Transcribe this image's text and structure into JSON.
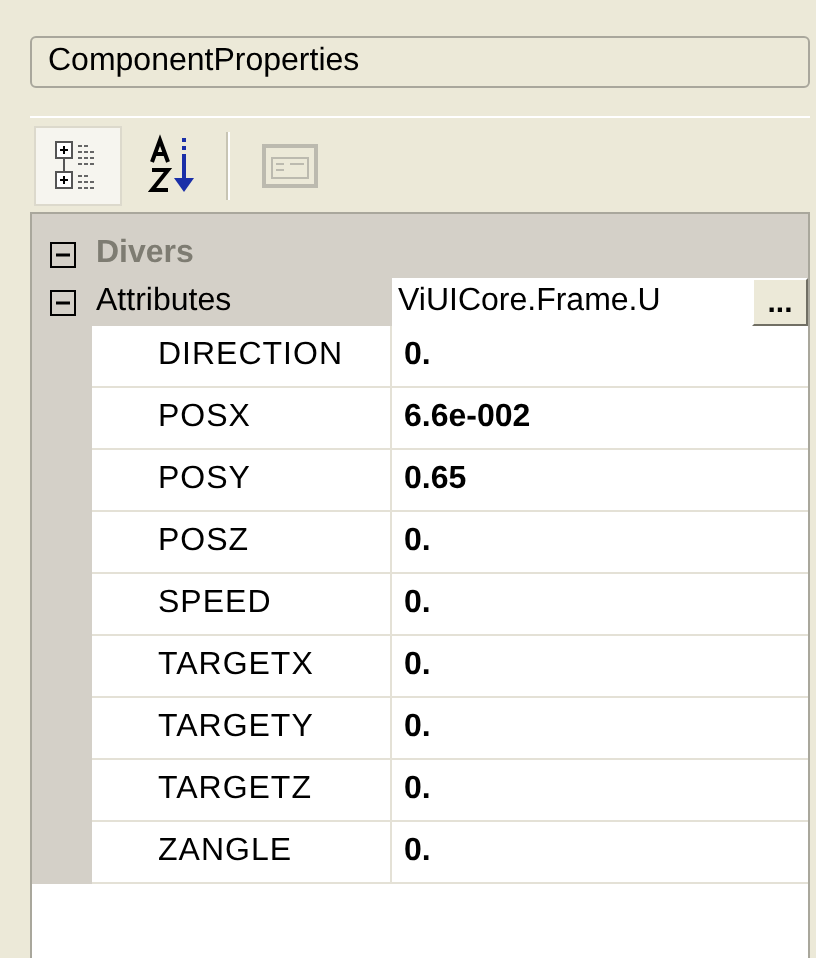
{
  "object_selector": {
    "value": "ComponentProperties"
  },
  "toolbar": [
    {
      "kind": "categorized",
      "selected": true,
      "disabled": false
    },
    {
      "kind": "alphabetical",
      "selected": false,
      "disabled": false
    },
    {
      "kind": "pages",
      "selected": false,
      "disabled": true
    }
  ],
  "categories": [
    {
      "label": "Divers",
      "expanded": true,
      "disabled": true
    },
    {
      "label": "Attributes",
      "expanded": true,
      "disabled": false,
      "value": "ViUICore.Frame.U",
      "button": "...",
      "children": [
        {
          "name": "DIRECTION",
          "value": "0."
        },
        {
          "name": "POSX",
          "value": "6.6e-002"
        },
        {
          "name": "POSY",
          "value": "0.65"
        },
        {
          "name": "POSZ",
          "value": "0."
        },
        {
          "name": "SPEED",
          "value": "0."
        },
        {
          "name": "TARGETX",
          "value": "0."
        },
        {
          "name": "TARGETY",
          "value": "0."
        },
        {
          "name": "TARGETZ",
          "value": "0."
        },
        {
          "name": "ZANGLE",
          "value": "0."
        }
      ]
    }
  ]
}
